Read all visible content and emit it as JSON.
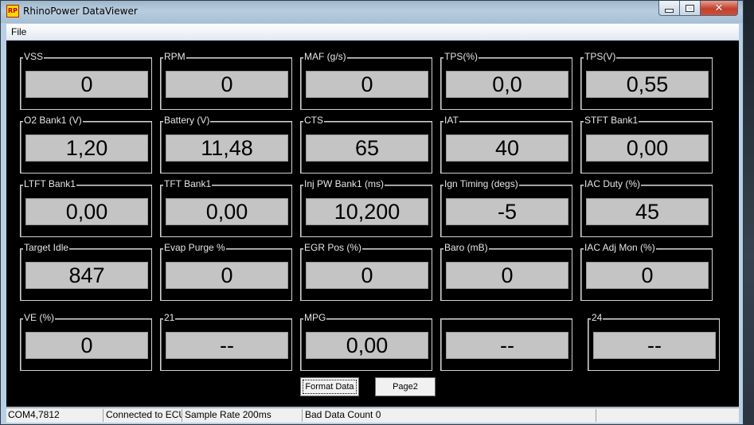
{
  "window": {
    "title": "RhinoPower DataViewer",
    "icon": "RP",
    "caption_buttons": {
      "minimize": "minimize-icon",
      "maximize": "maximize-icon",
      "close": "close-icon",
      "close_label": "✕"
    }
  },
  "menu": {
    "file_label": "File"
  },
  "gauges": [
    {
      "label": "VSS",
      "value": "0"
    },
    {
      "label": "RPM",
      "value": "0"
    },
    {
      "label": "MAF (g/s)",
      "value": "0"
    },
    {
      "label": "TPS(%)",
      "value": "0,0"
    },
    {
      "label": "TPS(V)",
      "value": "0,55"
    },
    {
      "label": "O2 Bank1 (V)",
      "value": "1,20"
    },
    {
      "label": "Battery (V)",
      "value": "11,48"
    },
    {
      "label": "CTS",
      "value": "65"
    },
    {
      "label": "IAT",
      "value": "40"
    },
    {
      "label": "STFT Bank1",
      "value": "0,00"
    },
    {
      "label": "LTFT Bank1",
      "value": "0,00"
    },
    {
      "label": "TFT Bank1",
      "value": "0,00"
    },
    {
      "label": "Inj PW Bank1 (ms)",
      "value": "10,200"
    },
    {
      "label": "Ign Timing (degs)",
      "value": "-5"
    },
    {
      "label": "IAC Duty (%)",
      "value": "45"
    },
    {
      "label": "Target Idle",
      "value": "847"
    },
    {
      "label": "Evap Purge %",
      "value": "0"
    },
    {
      "label": "EGR Pos (%)",
      "value": "0"
    },
    {
      "label": "Baro (mB)",
      "value": "0"
    },
    {
      "label": "IAC Adj Mon (%)",
      "value": "0"
    },
    {
      "label": "VE (%)",
      "value": "0"
    },
    {
      "label": "21",
      "value": "--"
    },
    {
      "label": "MPG",
      "value": "0,00"
    },
    {
      "label": "",
      "value": "--"
    },
    {
      "label": "24",
      "value": "--"
    }
  ],
  "buttons": {
    "format_data": "Format Data",
    "page2": "Page2"
  },
  "status": {
    "port": "COM4,7812",
    "connection": "Connected to ECU",
    "sample_rate": "Sample Rate 200ms",
    "bad_data": "Bad Data Count 0",
    "extra": ""
  },
  "colors": {
    "panel_bg": "#000000",
    "value_bg": "#c4c4c4",
    "label_text": "#e6e6e6"
  }
}
